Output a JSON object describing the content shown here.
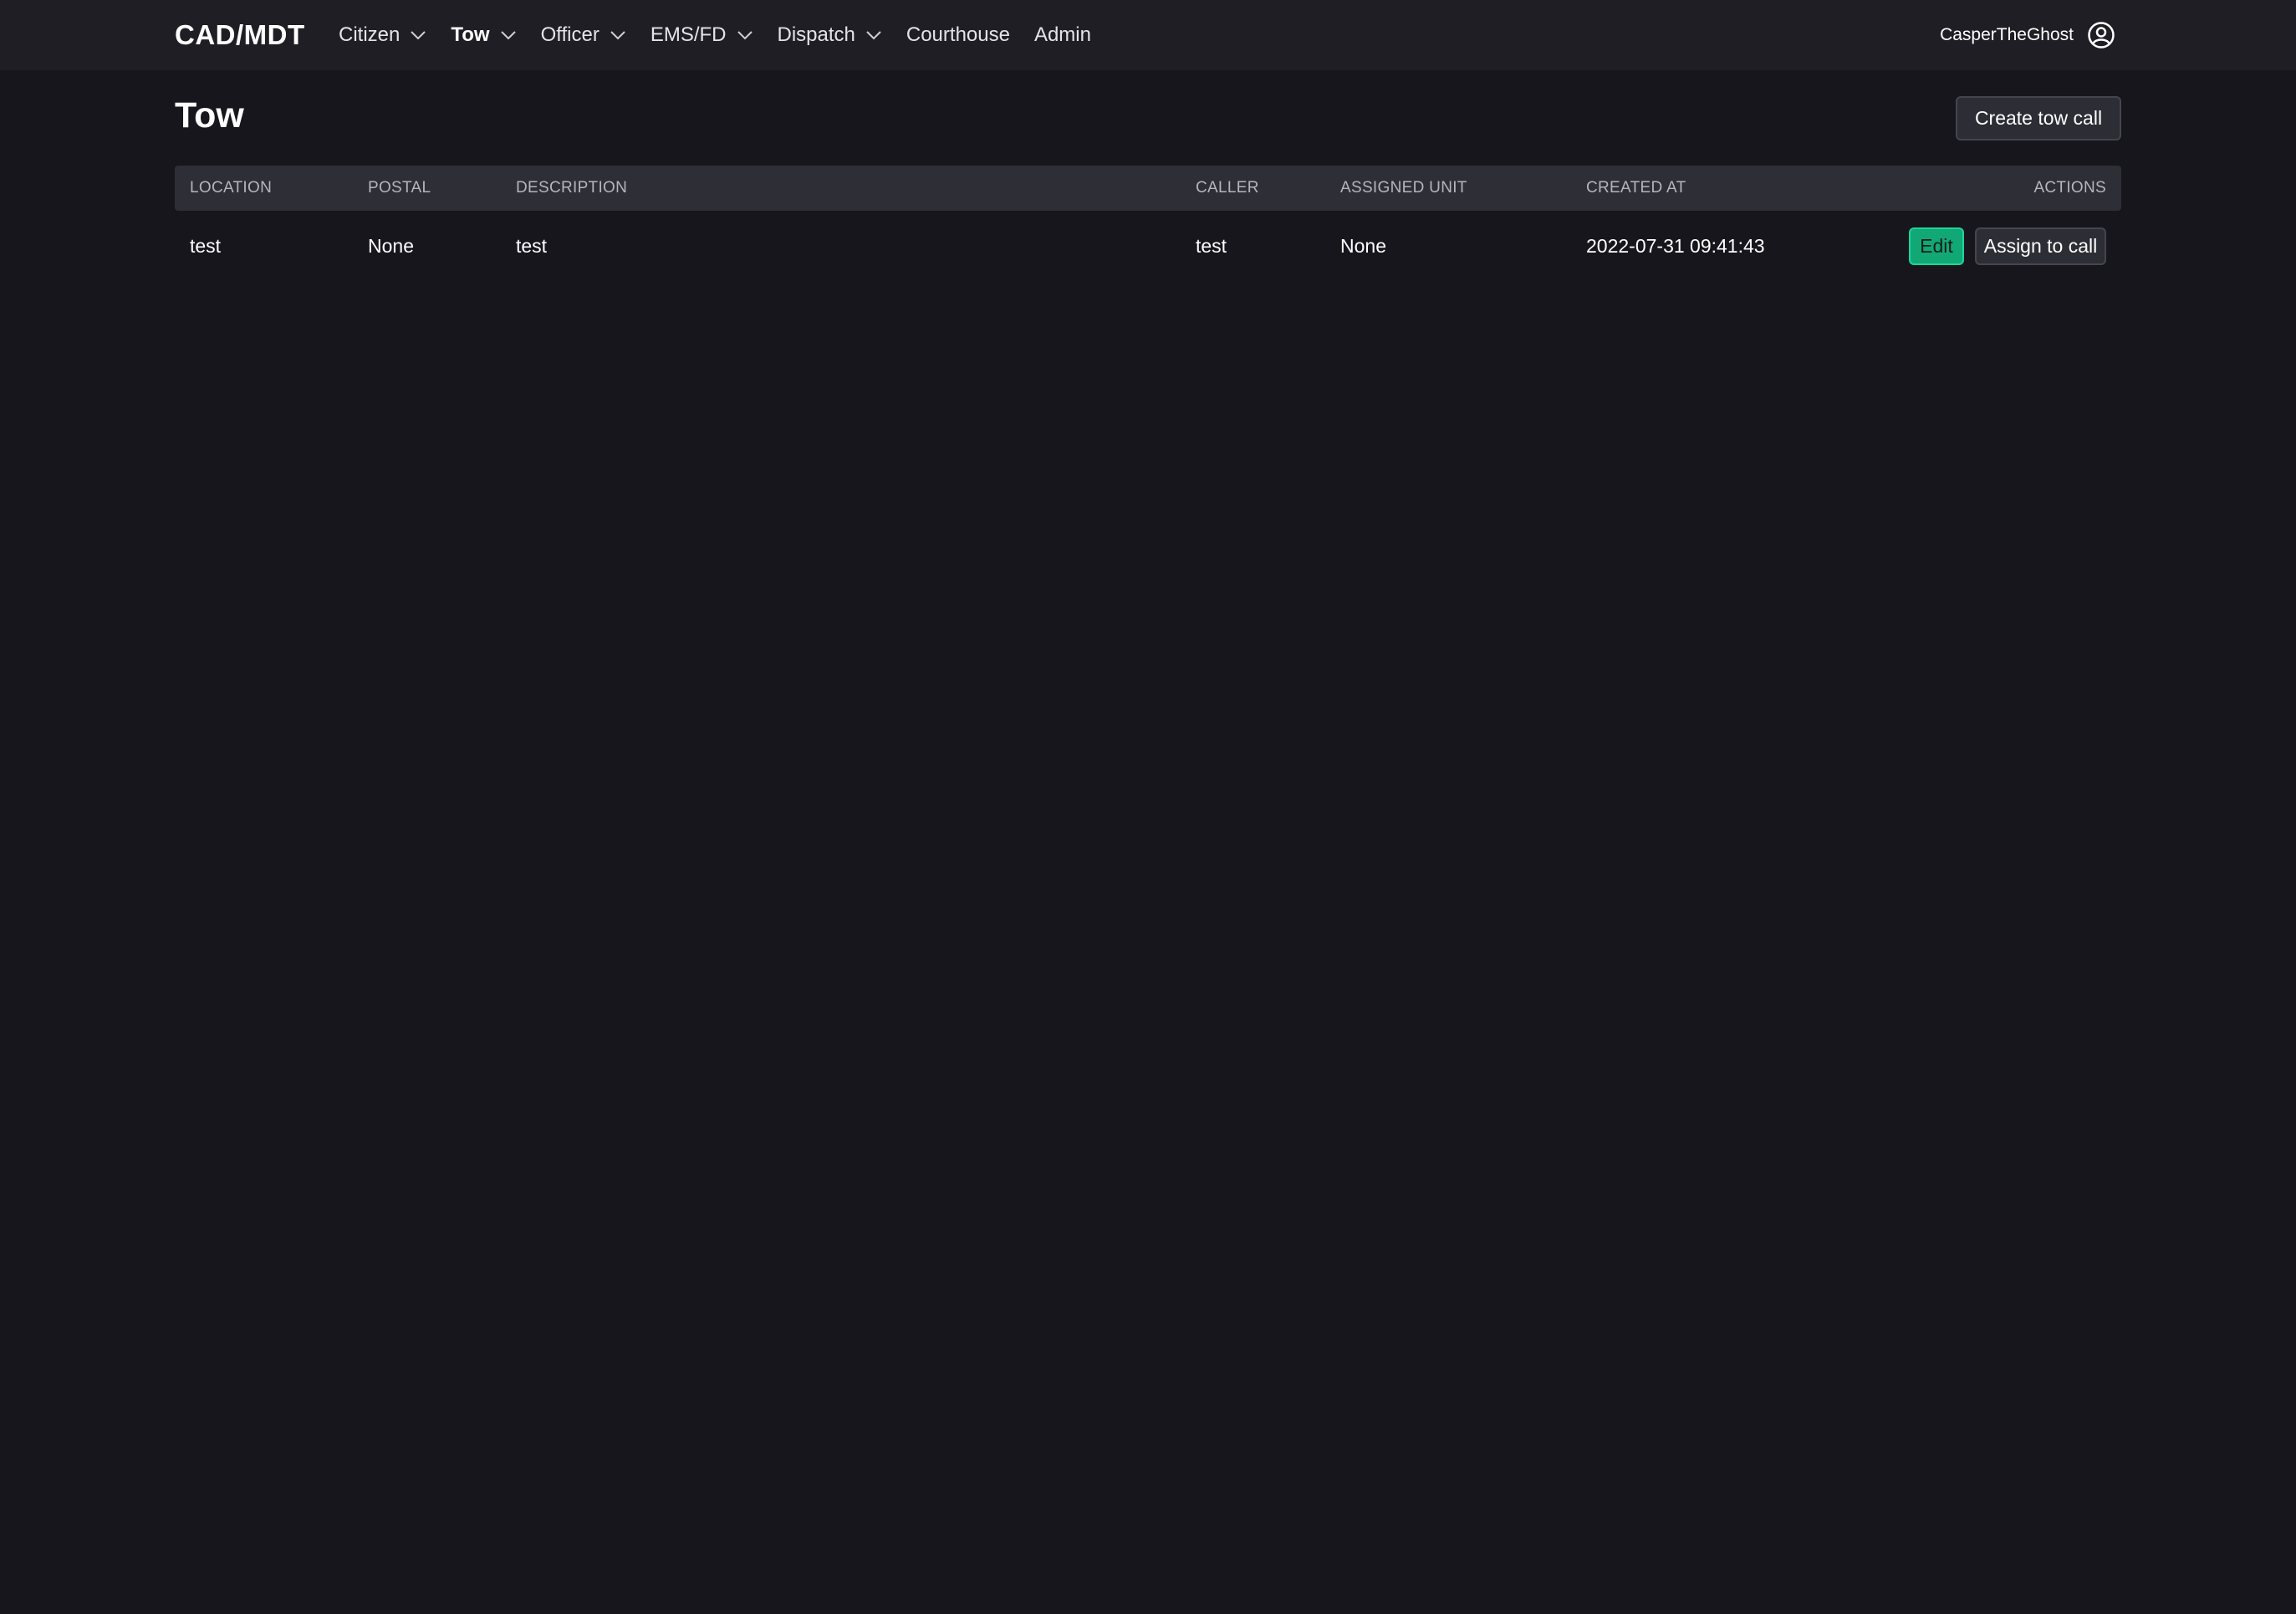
{
  "navbar": {
    "brand": "CAD/MDT",
    "items": [
      {
        "label": "Citizen",
        "dropdown": true,
        "active": false
      },
      {
        "label": "Tow",
        "dropdown": true,
        "active": true
      },
      {
        "label": "Officer",
        "dropdown": true,
        "active": false
      },
      {
        "label": "EMS/FD",
        "dropdown": true,
        "active": false
      },
      {
        "label": "Dispatch",
        "dropdown": true,
        "active": false
      },
      {
        "label": "Courthouse",
        "dropdown": false,
        "active": false
      },
      {
        "label": "Admin",
        "dropdown": false,
        "active": false
      }
    ],
    "username": "CasperTheGhost",
    "user_icon": "user-circle-icon"
  },
  "page": {
    "title": "Tow",
    "create_button": "Create tow call"
  },
  "table": {
    "headers": {
      "location": "LOCATION",
      "postal": "POSTAL",
      "description": "DESCRIPTION",
      "caller": "CALLER",
      "assigned_unit": "ASSIGNED UNIT",
      "created_at": "CREATED AT",
      "actions": "ACTIONS"
    },
    "rows": [
      {
        "location": "test",
        "postal": "None",
        "description": "test",
        "caller": "test",
        "assigned_unit": "None",
        "created_at": "2022-07-31 09:41:43",
        "edit_label": "Edit",
        "assign_label": "Assign to call"
      }
    ]
  },
  "colors": {
    "background": "#16161c",
    "navbar": "#1e1e24",
    "table_header": "#2e2e37",
    "edit_button": "#12a876"
  }
}
